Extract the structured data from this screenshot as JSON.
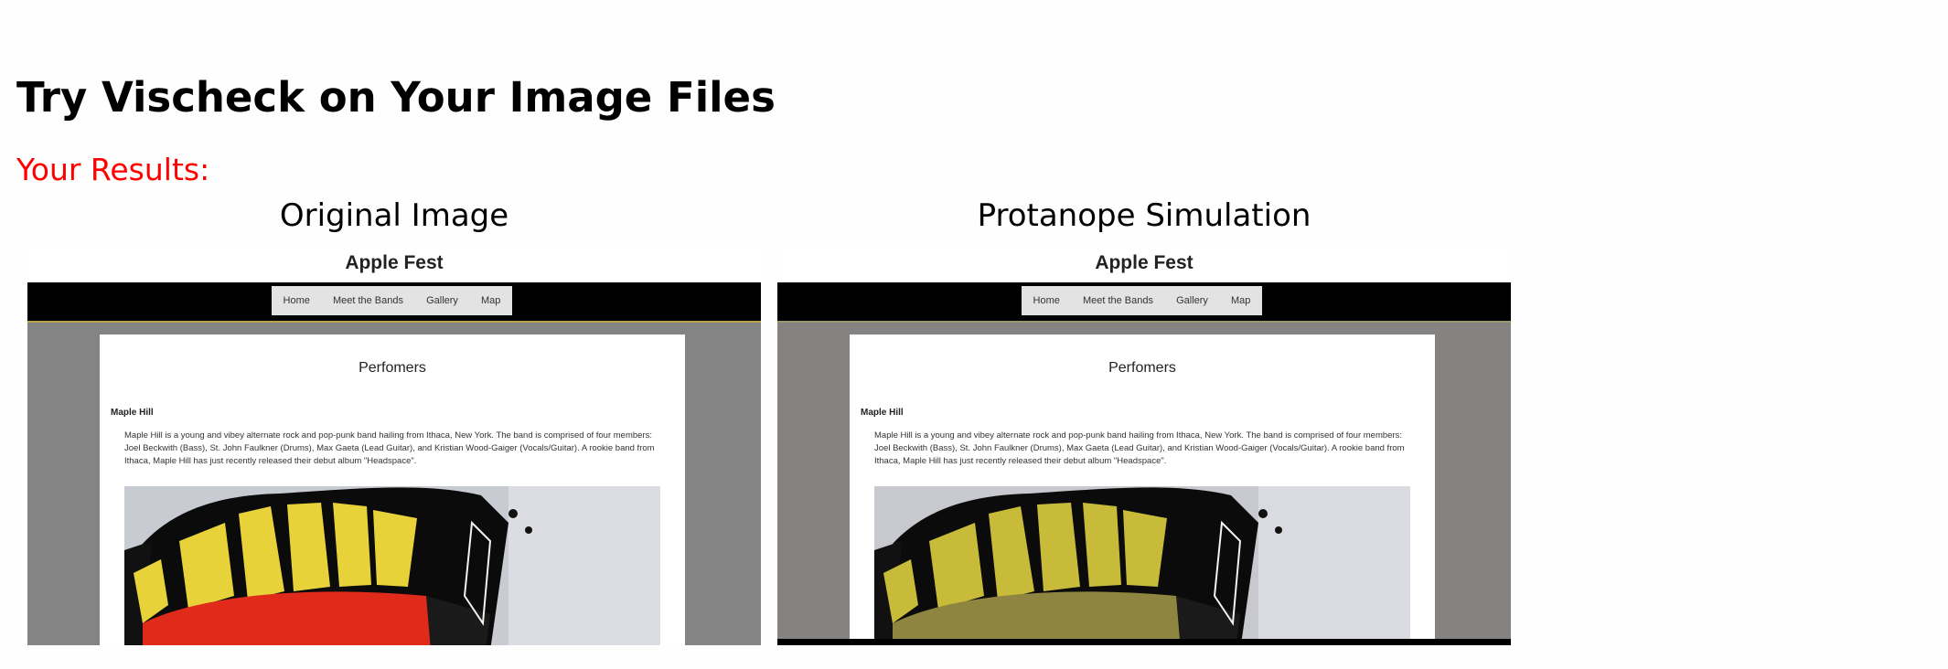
{
  "page": {
    "title": "Try Vischeck on Your Image Files",
    "results_label": "Your Results:",
    "original_heading": "Original Image",
    "simulation_heading": "Protanope Simulation"
  },
  "screenshot": {
    "site_title": "Apple Fest",
    "nav": [
      "Home",
      "Meet the Bands",
      "Gallery",
      "Map"
    ],
    "section_heading": "Perfomers",
    "band_name": "Maple Hill",
    "band_description": "Maple Hill is a young and vibey alternate rock and pop-punk band hailing from Ithaca, New York. The band is comprised of four members: Joel Beckwith (Bass), St. John Faulkner (Drums), Max Gaeta (Lead Guitar), and Kristian Wood-Gaiger (Vocals/Guitar). A rookie band from Ithaca, Maple Hill has just recently released their debut album \"Headspace\"."
  },
  "colors": {
    "results_label": "#ff0000",
    "original_red": "#e02a1a",
    "original_yellow": "#e8d23a",
    "simulated_yellow": "#c9bb3a",
    "simulated_red": "#8e8540"
  }
}
